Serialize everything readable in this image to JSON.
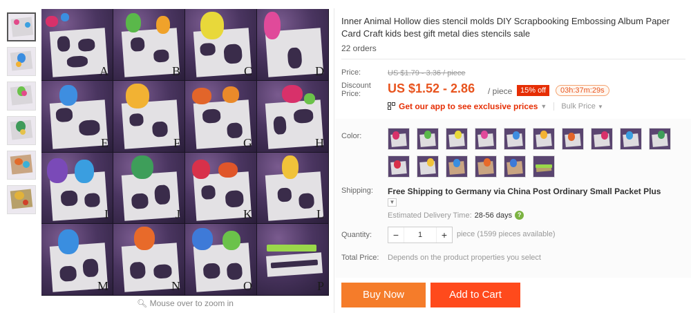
{
  "product": {
    "title": "Inner Animal Hollow dies stencil molds DIY Scrapbooking Embossing Album Paper Card Craft kids best gift metal dies stencils sale",
    "orders": "22 orders"
  },
  "gallery": {
    "thumbnails": [
      "thumb-1",
      "thumb-2",
      "thumb-3",
      "thumb-4",
      "thumb-5",
      "thumb-6"
    ],
    "image_letters": [
      "A",
      "B",
      "C",
      "D",
      "E",
      "F",
      "G",
      "H",
      "I",
      "J",
      "K",
      "L",
      "M",
      "N",
      "O",
      "P"
    ],
    "zoom_hint": "Mouse over to zoom in"
  },
  "price": {
    "label": "Price:",
    "original": "US $1.79 - 3.36 / piece",
    "discount_label": "Discount Price:",
    "sale": "US $1.52 - 2.86",
    "unit": "/ piece",
    "badge": "15% off",
    "timer": "03h:37m:29s",
    "app_promo": "Get our app to see exclusive prices",
    "bulk_price": "Bulk Price"
  },
  "color": {
    "label": "Color:",
    "swatch_count": 16
  },
  "shipping": {
    "label": "Shipping:",
    "text": "Free Shipping to Germany via China Post Ordinary Small Packet Plus",
    "delivery_label": "Estimated Delivery Time:",
    "delivery_days": "28-56 days"
  },
  "quantity": {
    "label": "Quantity:",
    "value": "1",
    "note": "piece (1599 pieces available)"
  },
  "total": {
    "label": "Total Price:",
    "text": "Depends on the product properties you select"
  },
  "actions": {
    "buy_now": "Buy Now",
    "add_to_cart": "Add to Cart"
  },
  "colors": {
    "accent_orange": "#e8541e",
    "buy_button": "#f57c2a",
    "cart_button": "#ff4a1c",
    "badge_red": "#e62e04"
  }
}
